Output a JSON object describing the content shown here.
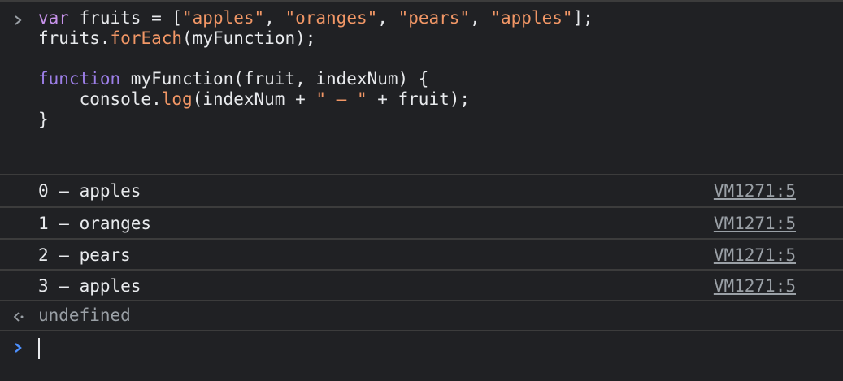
{
  "console": {
    "input": {
      "lines": [
        [
          {
            "t": "var",
            "c": "kw"
          },
          {
            "t": " fruits = [",
            "c": ""
          },
          {
            "t": "\"apples\"",
            "c": "str"
          },
          {
            "t": ", ",
            "c": ""
          },
          {
            "t": "\"oranges\"",
            "c": "str"
          },
          {
            "t": ", ",
            "c": ""
          },
          {
            "t": "\"pears\"",
            "c": "str"
          },
          {
            "t": ", ",
            "c": ""
          },
          {
            "t": "\"apples\"",
            "c": "str"
          },
          {
            "t": "];",
            "c": ""
          }
        ],
        [
          {
            "t": "fruits.",
            "c": ""
          },
          {
            "t": "forEach",
            "c": "fn"
          },
          {
            "t": "(myFunction);",
            "c": ""
          }
        ],
        [],
        [
          {
            "t": "function",
            "c": "kw2"
          },
          {
            "t": " myFunction(fruit, indexNum) {",
            "c": ""
          }
        ],
        [
          {
            "t": "    console.",
            "c": ""
          },
          {
            "t": "log",
            "c": "fn"
          },
          {
            "t": "(indexNum + ",
            "c": ""
          },
          {
            "t": "\" – \"",
            "c": "str"
          },
          {
            "t": " + fruit);",
            "c": ""
          }
        ],
        [
          {
            "t": "}",
            "c": ""
          }
        ]
      ]
    },
    "logs": [
      {
        "text": "0 – apples",
        "source": "VM1271:5"
      },
      {
        "text": "1 – oranges",
        "source": "VM1271:5"
      },
      {
        "text": "2 – pears",
        "source": "VM1271:5"
      },
      {
        "text": "3 – apples",
        "source": "VM1271:5"
      }
    ],
    "result": "undefined",
    "prompt_value": "",
    "colors": {
      "background": "#202124",
      "keyword": "#c792ea",
      "string": "#f29766",
      "prompt_accent": "#4d90fe",
      "muted": "#9aa0a6"
    },
    "icons": {
      "input_prompt": "chevron-right-icon",
      "result": "return-arrow-icon",
      "active_prompt": "chevron-right-icon"
    }
  }
}
